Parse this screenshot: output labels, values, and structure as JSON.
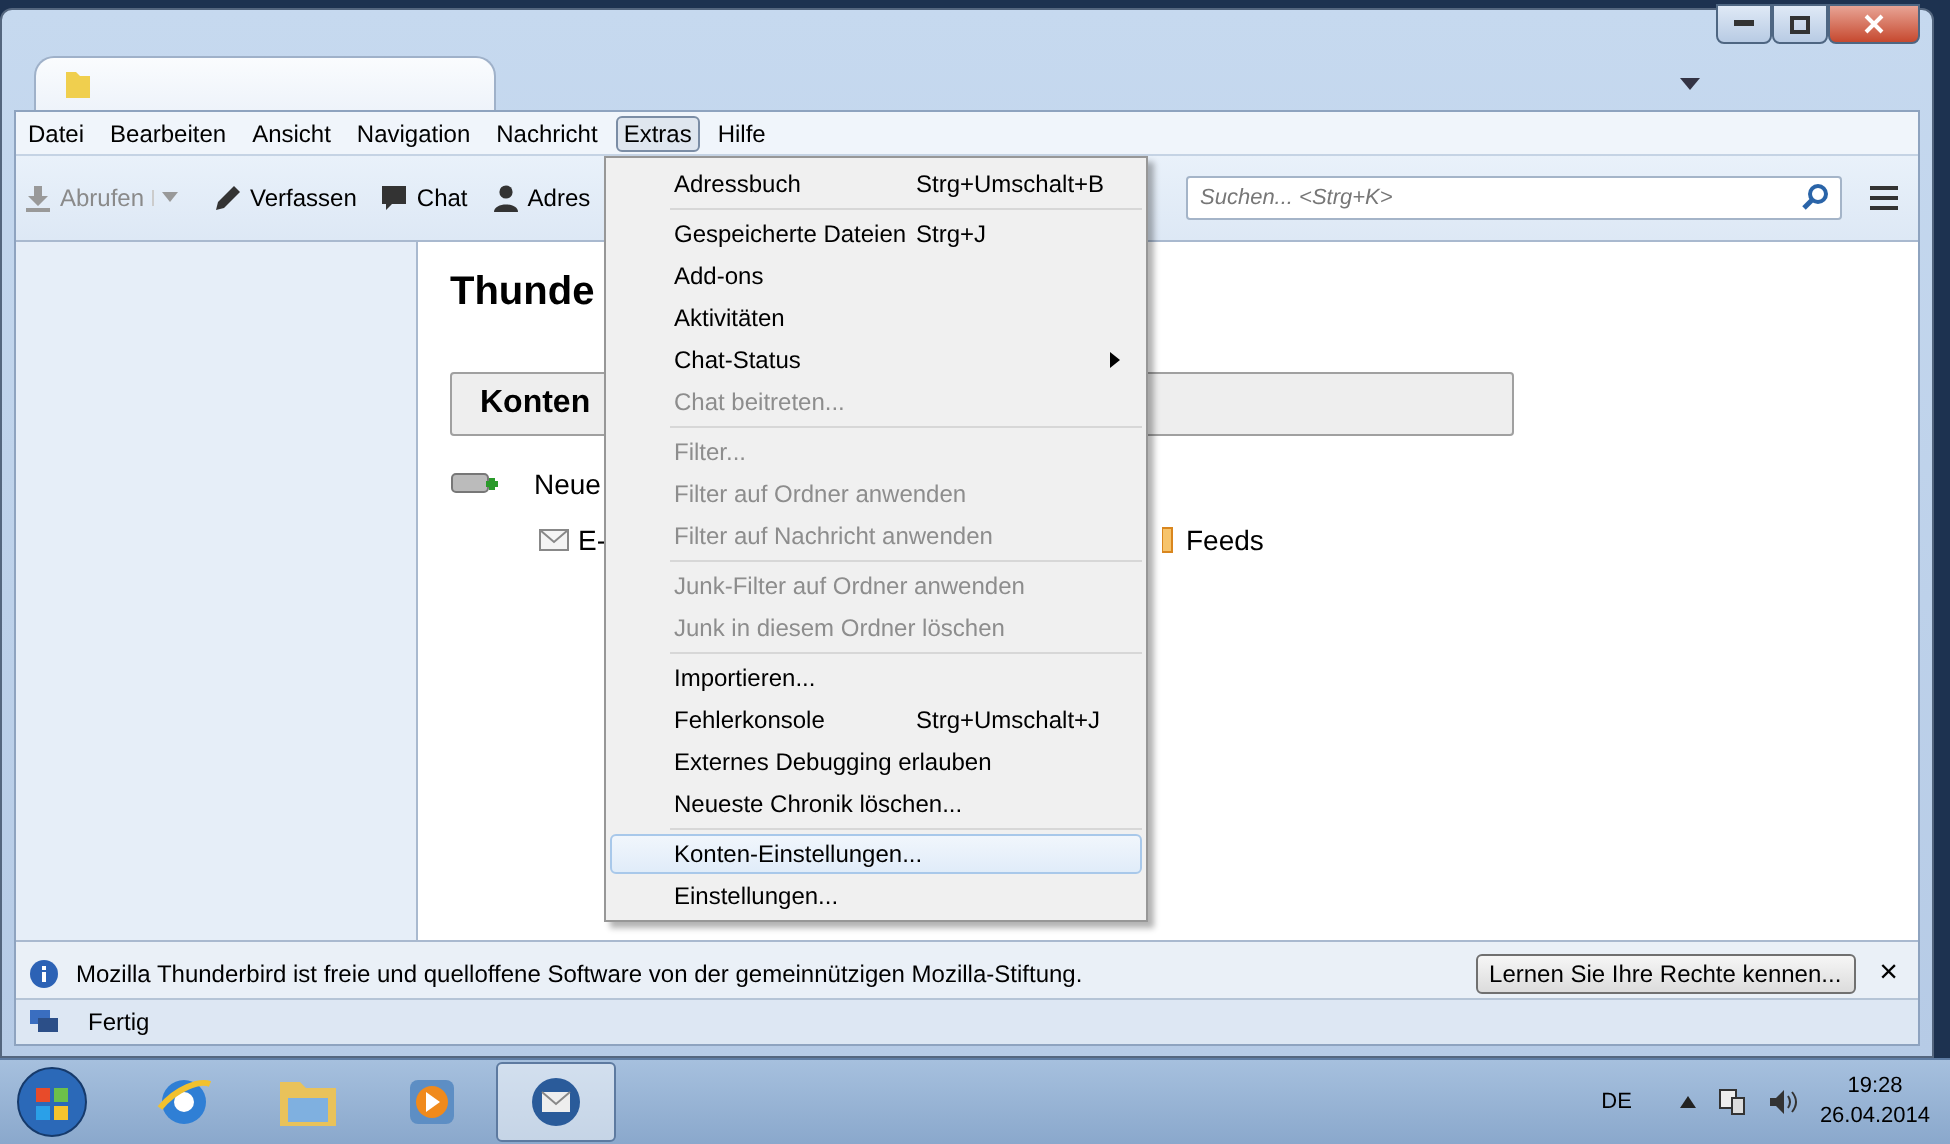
{
  "menubar": [
    {
      "label": "Datei",
      "selected": false
    },
    {
      "label": "Bearbeiten",
      "selected": false
    },
    {
      "label": "Ansicht",
      "selected": false
    },
    {
      "label": "Navigation",
      "selected": false
    },
    {
      "label": "Nachricht",
      "selected": false
    },
    {
      "label": "Extras",
      "selected": true
    },
    {
      "label": "Hilfe",
      "selected": false
    }
  ],
  "toolbar": {
    "buttons": [
      {
        "label": "Abrufen",
        "disabled": true,
        "dropdown": true
      },
      {
        "label": "Verfassen",
        "disabled": false,
        "dropdown": false
      },
      {
        "label": "Chat",
        "disabled": false,
        "dropdown": false
      },
      {
        "label": "Adres",
        "disabled": false,
        "dropdown": false
      }
    ],
    "search": {
      "placeholder": "Suchen... <Strg+K>"
    }
  },
  "content": {
    "heading": "Thunde",
    "section": "Konten",
    "new_item": "Neue",
    "email_item": "E-",
    "feeds_item": "Feeds"
  },
  "extras_menu": [
    [
      {
        "label": "Adressbuch",
        "shortcut": "Strg+Umschalt+B",
        "disabled": false,
        "submenu": false,
        "selected": false
      }
    ],
    [
      {
        "label": "Gespeicherte Dateien",
        "shortcut": "Strg+J",
        "disabled": false,
        "submenu": false,
        "selected": false
      },
      {
        "label": "Add-ons",
        "disabled": false,
        "submenu": false,
        "selected": false
      },
      {
        "label": "Aktivitäten",
        "disabled": false,
        "submenu": false,
        "selected": false
      },
      {
        "label": "Chat-Status",
        "disabled": false,
        "submenu": true,
        "selected": false
      },
      {
        "label": "Chat beitreten...",
        "disabled": true,
        "submenu": false,
        "selected": false
      }
    ],
    [
      {
        "label": "Filter...",
        "disabled": true,
        "submenu": false,
        "selected": false
      },
      {
        "label": "Filter auf Ordner anwenden",
        "disabled": true,
        "submenu": false,
        "selected": false
      },
      {
        "label": "Filter auf Nachricht anwenden",
        "disabled": true,
        "submenu": false,
        "selected": false
      }
    ],
    [
      {
        "label": "Junk-Filter auf Ordner anwenden",
        "disabled": true,
        "submenu": false,
        "selected": false
      },
      {
        "label": "Junk in diesem Ordner löschen",
        "disabled": true,
        "submenu": false,
        "selected": false
      }
    ],
    [
      {
        "label": "Importieren...",
        "disabled": false,
        "submenu": false,
        "selected": false
      },
      {
        "label": "Fehlerkonsole",
        "shortcut": "Strg+Umschalt+J",
        "disabled": false,
        "submenu": false,
        "selected": false
      },
      {
        "label": "Externes Debugging erlauben",
        "disabled": false,
        "submenu": false,
        "selected": false
      },
      {
        "label": "Neueste Chronik löschen...",
        "disabled": false,
        "submenu": false,
        "selected": false
      }
    ],
    [
      {
        "label": "Konten-Einstellungen...",
        "disabled": false,
        "submenu": false,
        "selected": true
      },
      {
        "label": "Einstellungen...",
        "disabled": false,
        "submenu": false,
        "selected": false
      }
    ]
  ],
  "notification": {
    "text": "Mozilla Thunderbird ist freie und quelloffene Software von der gemeinnützigen Mozilla-Stiftung.",
    "button": "Lernen Sie Ihre Rechte kennen...",
    "close": "×"
  },
  "status_bar": {
    "text": "Fertig"
  },
  "taskbar": {
    "apps": [
      {
        "kind": "browser",
        "selected": false
      },
      {
        "kind": "folder",
        "selected": false
      },
      {
        "kind": "player",
        "selected": false
      },
      {
        "kind": "mail",
        "selected": true
      }
    ],
    "language": "DE",
    "time": "19:28",
    "date": "26.04.2014"
  }
}
